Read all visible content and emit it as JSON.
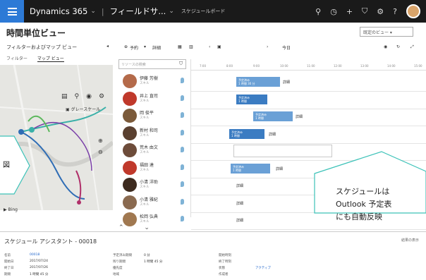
{
  "topbar": {
    "app_name": "Dynamics 365",
    "chevron": "⌄",
    "module": "フィールドサ...",
    "page": "スケジュールボード",
    "icons": [
      "search-icon",
      "clock-icon",
      "plus-icon",
      "filter-icon",
      "gear-icon",
      "help-icon"
    ]
  },
  "page": {
    "title": "時間単位ビュー",
    "view_select": "既定のビュー"
  },
  "left_panel": {
    "header": "フィルターおよびマップ ビュー",
    "tabs": [
      "フィルター",
      "マップ ビュー"
    ],
    "map_option": "グレースケール",
    "map_attribution": "Bing"
  },
  "toolbar": {
    "book": "予約",
    "details": "詳細",
    "today": "今日"
  },
  "resources": {
    "search_placeholder": "リソースの検索",
    "items": [
      {
        "name": "伊藤 芳樹",
        "sub": "スキル",
        "color": "#b46a4a"
      },
      {
        "name": "井上 直司",
        "sub": "スキル",
        "color": "#c0392b"
      },
      {
        "name": "岡 俊平",
        "sub": "スキル",
        "color": "#7b5a3a"
      },
      {
        "name": "新村 和司",
        "sub": "スキル",
        "color": "#5a4030"
      },
      {
        "name": "荒木 由文",
        "sub": "スキル",
        "color": "#6d4c3a"
      },
      {
        "name": "福田 達",
        "sub": "スキル",
        "color": "#c0392b"
      },
      {
        "name": "小清 洋助",
        "sub": "スキル",
        "color": "#3d2b1f"
      },
      {
        "name": "小清 雅紀",
        "sub": "スキル",
        "color": "#8a6a50"
      },
      {
        "name": "松岡 弘典",
        "sub": "スキル",
        "color": "#a07850"
      }
    ]
  },
  "board": {
    "hours": [
      "7:00",
      "8:00",
      "9:00",
      "10:00",
      "11:00",
      "12:00",
      "13:00",
      "14:00",
      "15:00"
    ],
    "bookings": [
      {
        "title": "予定済み",
        "sub": "1 時間 30 分",
        "label": "詳細"
      },
      {
        "title": "予定済み",
        "sub": "1 時間",
        "label": ""
      },
      {
        "title": "予定済み",
        "sub": "1 時間",
        "label": "詳細"
      },
      {
        "title": "予定済み",
        "sub": "1 時間",
        "label": "詳細"
      },
      {
        "title": "予定済み",
        "sub": "1 時間",
        "label": "詳細"
      }
    ],
    "row_labels": [
      "詳細",
      "詳細",
      "詳細",
      "詳細"
    ]
  },
  "bottom": {
    "title": "スケジュール アシスタント - 00018",
    "right_link": "結果の表示",
    "fields": [
      {
        "k": "名前",
        "v": "00018",
        "link": true
      },
      {
        "k": "開始日",
        "v": "2017/07/24"
      },
      {
        "k": "終了日",
        "v": "2017/07/26"
      },
      {
        "k": "期間",
        "v": "1 時間 45 分"
      }
    ],
    "fields2": [
      {
        "k": "予定済み期間",
        "v": "0 分"
      },
      {
        "k": "残り期間",
        "v": "1 時間 45 分"
      },
      {
        "k": "優先度",
        "v": ""
      },
      {
        "k": "地域",
        "v": ""
      }
    ],
    "fields3": [
      {
        "k": "開始時刻",
        "v": ""
      },
      {
        "k": "終了時刻",
        "v": ""
      },
      {
        "k": "状態",
        "v": "アクティブ",
        "link": true
      },
      {
        "k": "作成者",
        "v": ""
      }
    ]
  },
  "callouts": {
    "left": "図",
    "right": [
      "スケジュールは",
      "Outlook 予定表",
      "にも自動反映"
    ]
  },
  "colors": {
    "topbar": "#1a1a1a",
    "accent": "#2d7ad6",
    "booking": "#6aa0d6",
    "callout_border": "#3cc2b8"
  }
}
